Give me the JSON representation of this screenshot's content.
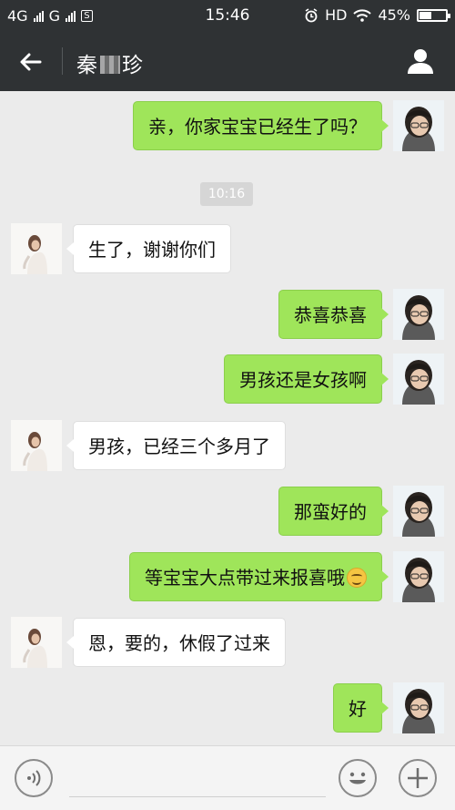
{
  "status_bar": {
    "network_1": "4G",
    "network_2": "G",
    "time": "15:46",
    "hd": "HD",
    "battery": "45%",
    "battery_level": 0.45
  },
  "header": {
    "title_prefix": "秦",
    "title_suffix": "珍"
  },
  "chat": {
    "timestamp": "10:16",
    "messages": [
      {
        "from": "me",
        "text": "亲，你家宝宝已经生了吗？"
      },
      {
        "from": "other",
        "text": "生了，谢谢你们"
      },
      {
        "from": "me",
        "text": "恭喜恭喜"
      },
      {
        "from": "me",
        "text": "男孩还是女孩啊"
      },
      {
        "from": "other",
        "text": "男孩，已经三个多月了"
      },
      {
        "from": "me",
        "text": "那蛮好的"
      },
      {
        "from": "me",
        "text": "等宝宝大点带过来报喜哦"
      },
      {
        "from": "other",
        "text": "恩，要的，休假了过来"
      },
      {
        "from": "me",
        "text": "好"
      }
    ]
  },
  "colors": {
    "header_bg": "#2f3234",
    "my_bubble": "#9fe55a",
    "other_bubble": "#ffffff",
    "chat_bg": "#ebebeb"
  }
}
